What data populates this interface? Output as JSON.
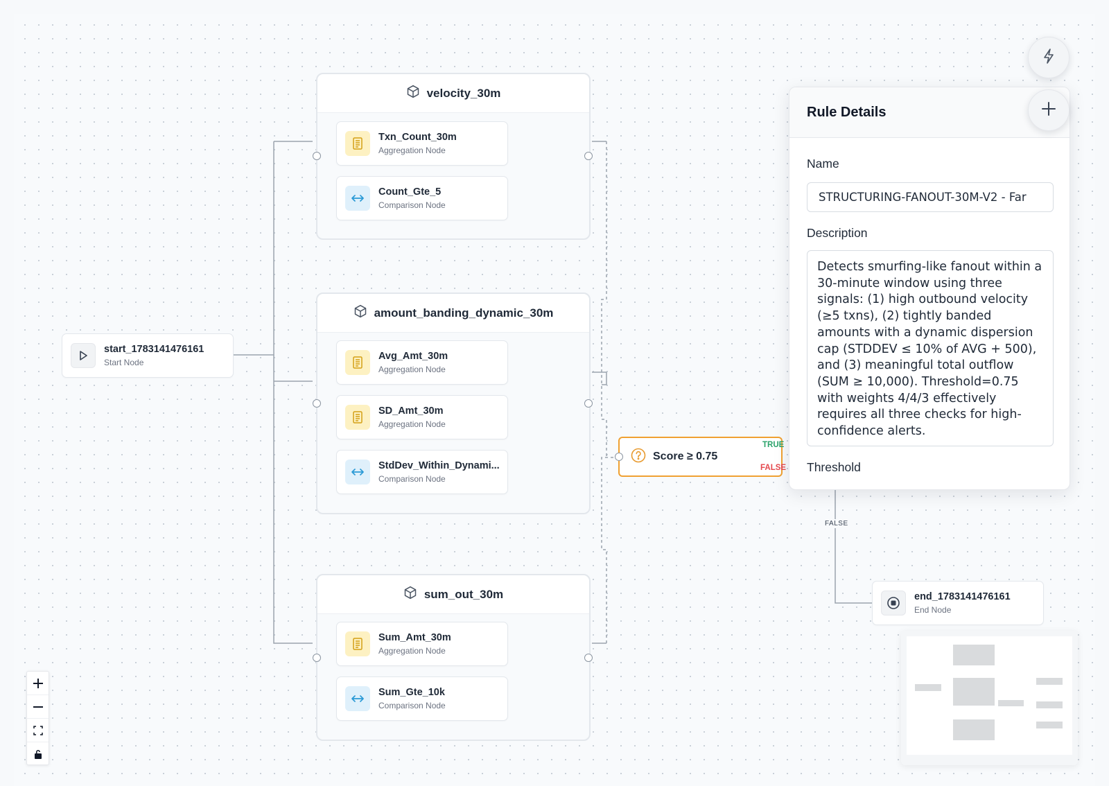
{
  "canvas": {
    "groups": [
      {
        "title": "velocity_30m",
        "nodes": [
          {
            "title": "Txn_Count_30m",
            "subtitle": "Aggregation Node",
            "kind": "aggregation"
          },
          {
            "title": "Count_Gte_5",
            "subtitle": "Comparison Node",
            "kind": "comparison"
          }
        ]
      },
      {
        "title": "amount_banding_dynamic_30m",
        "nodes": [
          {
            "title": "Avg_Amt_30m",
            "subtitle": "Aggregation Node",
            "kind": "aggregation"
          },
          {
            "title": "SD_Amt_30m",
            "subtitle": "Aggregation Node",
            "kind": "aggregation"
          },
          {
            "title": "StdDev_Within_Dynami...",
            "subtitle": "Comparison Node",
            "kind": "comparison"
          }
        ]
      },
      {
        "title": "sum_out_30m",
        "nodes": [
          {
            "title": "Sum_Amt_30m",
            "subtitle": "Aggregation Node",
            "kind": "aggregation"
          },
          {
            "title": "Sum_Gte_10k",
            "subtitle": "Comparison Node",
            "kind": "comparison"
          }
        ]
      }
    ],
    "start_node": {
      "title": "start_1783141476161",
      "subtitle": "Start Node"
    },
    "end_node": {
      "title": "end_1783141476161",
      "subtitle": "End Node"
    },
    "decision_node": {
      "label": "Score ≥ 0.75",
      "true_label": "TRUE",
      "false_label": "FALSE"
    },
    "edge_false_label": "FALSE"
  },
  "rule_panel": {
    "title": "Rule Details",
    "name_label": "Name",
    "name_value": "STRUCTURING-FANOUT-30M-V2 - Far",
    "description_label": "Description",
    "description_value": "Detects smurfing-like fanout within a 30-minute window using three signals: (1) high outbound velocity (≥5 txns), (2) tightly banded amounts with a dynamic dispersion cap (STDDEV ≤ 10% of AVG + 500), and (3) meaningful total outflow (SUM ≥ 10,000). Threshold=0.75 with weights 4/4/3 effectively requires all three checks for high-confidence alerts.",
    "threshold_label": "Threshold"
  },
  "colors": {
    "decision_border": "#f0a132",
    "true": "#2ba36b",
    "false": "#e5484d",
    "aggregation_icon_bg": "#fdf1c2",
    "comparison_icon_bg": "#dff0fb"
  },
  "icons": {
    "fab_top": "lightning-icon",
    "fab_panel": "plus-icon",
    "group": "cube-icon",
    "aggregation": "document-icon",
    "comparison": "arrows-horizontal-icon",
    "start": "play-icon",
    "end": "stop-icon",
    "decision": "question-icon"
  }
}
